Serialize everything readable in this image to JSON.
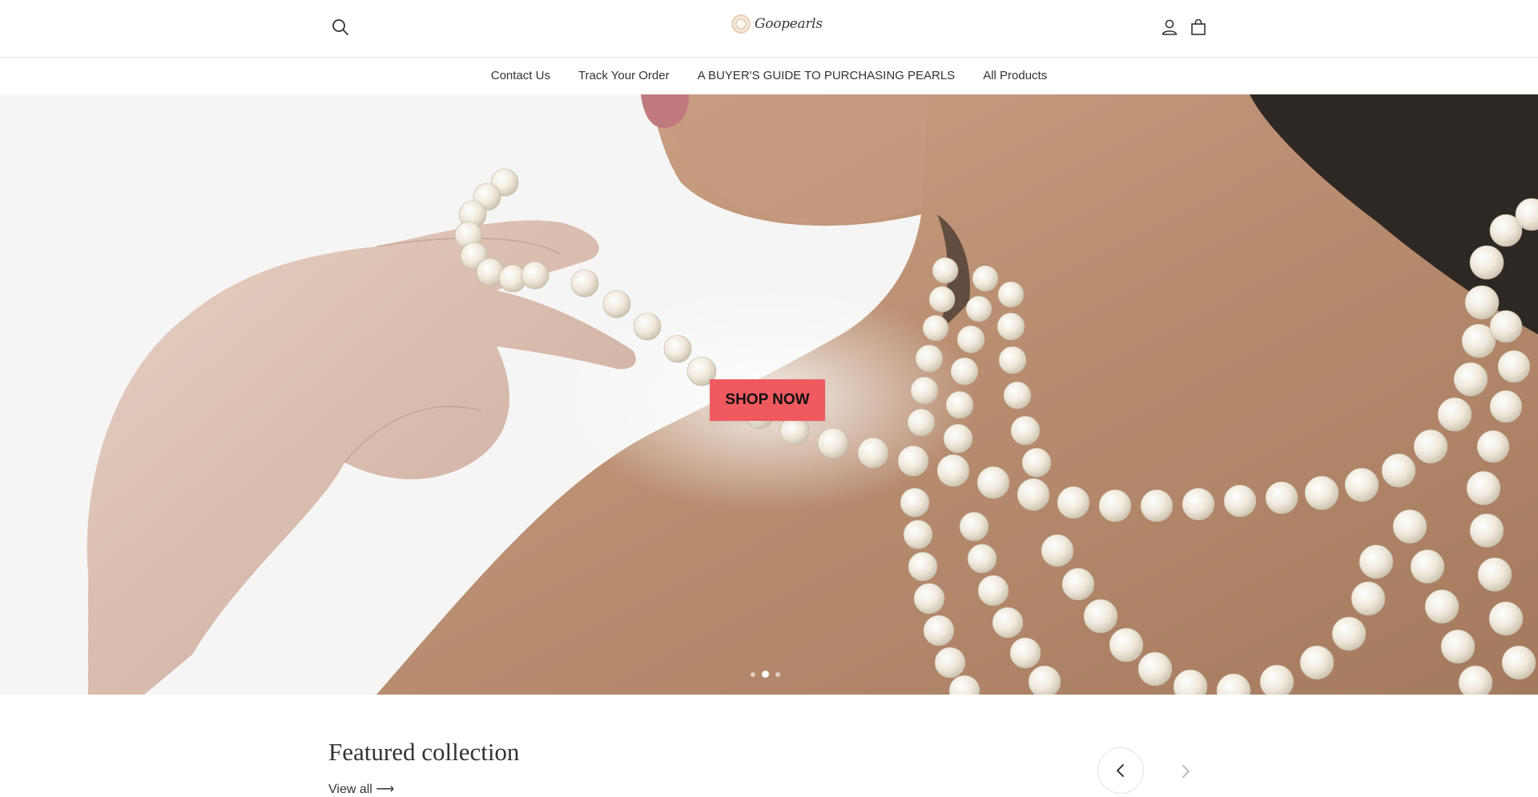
{
  "header": {
    "logo_text": "Goopearls",
    "icons": {
      "search": "search-icon",
      "account": "account-icon",
      "cart": "cart-icon"
    }
  },
  "nav": {
    "items": [
      {
        "label": "Contact Us"
      },
      {
        "label": "Track Your Order"
      },
      {
        "label": "A BUYER'S GUIDE TO PURCHASING PEARLS"
      },
      {
        "label": "All Products"
      }
    ]
  },
  "hero": {
    "cta_label": "SHOP NOW",
    "cta_color": "#f05a5f",
    "slides_total": 3,
    "active_slide": 2
  },
  "featured": {
    "title": "Featured collection",
    "view_all_label": "View all",
    "view_all_arrow": "⟶"
  },
  "colors": {
    "text": "#333333",
    "border": "#e4e4e4"
  }
}
